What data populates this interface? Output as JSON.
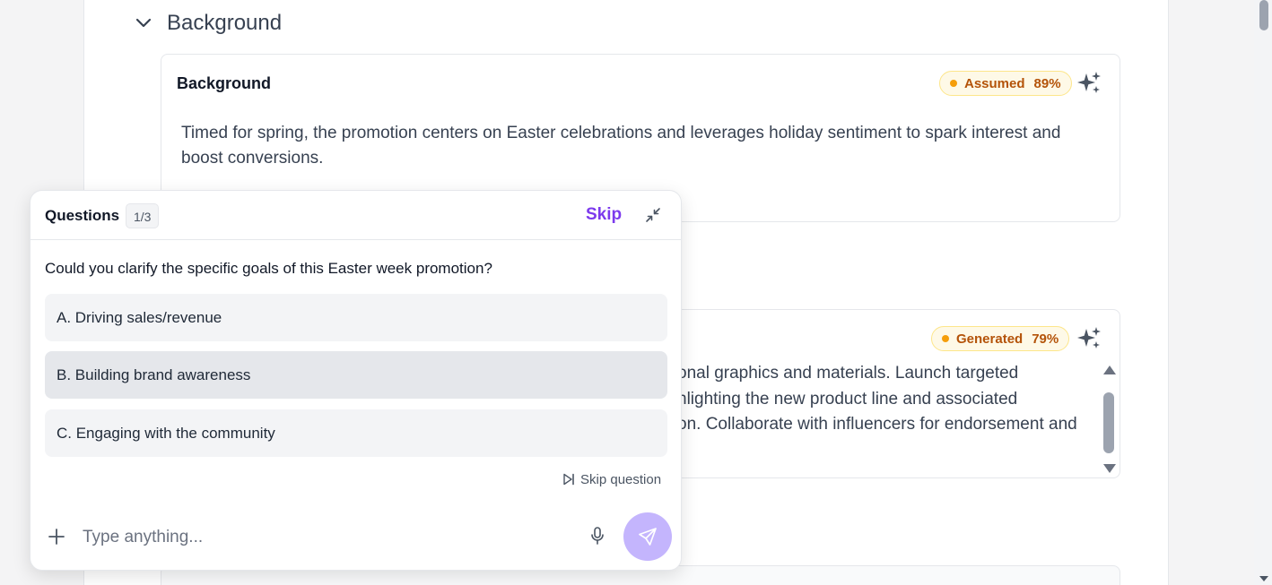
{
  "section": {
    "title": "Background"
  },
  "cards": [
    {
      "title": "Background",
      "badge": {
        "label": "Assumed",
        "percent": "89%"
      },
      "body": "Timed for spring, the promotion centers on Easter celebrations and leverages holiday sentiment to spark interest and boost conversions."
    },
    {
      "badge": {
        "label": "Generated",
        "percent": "79%"
      },
      "lines": [
        "onal graphics and materials. Launch targeted",
        "hlighting the new product line and associated",
        "on. Collaborate with influencers for endorsement and"
      ]
    }
  ],
  "questions": {
    "title": "Questions",
    "count": "1/3",
    "skip_label": "Skip",
    "question": "Could you clarify the specific goals of this Easter week promotion?",
    "options": [
      "A. Driving sales/revenue",
      "B. Building brand awareness",
      "C. Engaging with the community"
    ],
    "skip_question_label": "Skip question",
    "input_placeholder": "Type anything..."
  },
  "colors": {
    "accent": "#7c3aed",
    "send_button": "#c4b5fd",
    "badge_text": "#b45309",
    "badge_bg": "#fef9e7",
    "badge_dot": "#f59e0b"
  },
  "icons": [
    "chevron-down-icon",
    "sparkle-icon",
    "collapse-icon",
    "skip-forward-icon",
    "plus-icon",
    "microphone-icon",
    "send-icon"
  ]
}
